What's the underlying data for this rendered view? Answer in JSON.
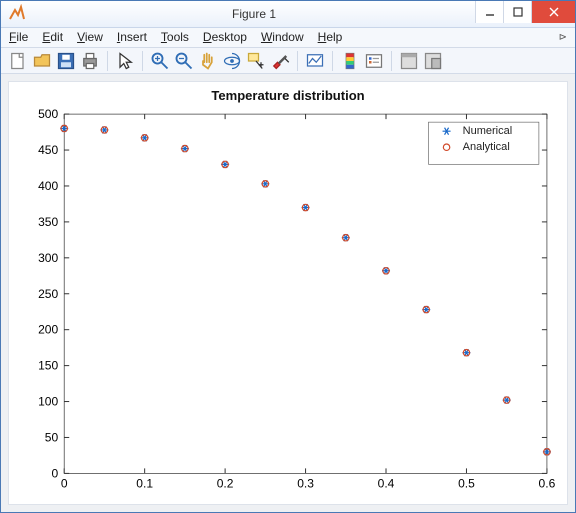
{
  "window": {
    "title": "Figure 1"
  },
  "menu": {
    "file": "File",
    "edit": "Edit",
    "view": "View",
    "insert": "Insert",
    "tools": "Tools",
    "desktop": "Desktop",
    "window": "Window",
    "help": "Help"
  },
  "tool_names": {
    "new": "new-figure",
    "open": "open",
    "save": "save",
    "print": "print",
    "pointer": "pointer",
    "zoomin": "zoom-in",
    "zoomout": "zoom-out",
    "pan": "pan",
    "rotate": "rotate-3d",
    "datacursor": "data-cursor",
    "brush": "brush",
    "link": "link-plots",
    "colorbar": "insert-colorbar",
    "legend": "insert-legend",
    "hide": "hide-tools",
    "dock": "dock-figure"
  },
  "chart_data": {
    "type": "scatter",
    "title": "Temperature distribution",
    "xlabel": "",
    "ylabel": "",
    "xlim": [
      0,
      0.6
    ],
    "ylim": [
      0,
      500
    ],
    "xticks": [
      0,
      0.1,
      0.2,
      0.3,
      0.4,
      0.5,
      0.6
    ],
    "yticks": [
      0,
      50,
      100,
      150,
      200,
      250,
      300,
      350,
      400,
      450,
      500
    ],
    "x": [
      0.0,
      0.05,
      0.1,
      0.15,
      0.2,
      0.25,
      0.3,
      0.35,
      0.4,
      0.45,
      0.5,
      0.55,
      0.6
    ],
    "series": [
      {
        "name": "Numerical",
        "marker": "star",
        "color": "#1868c9",
        "values": [
          480,
          478,
          467,
          452,
          430,
          403,
          370,
          328,
          282,
          228,
          168,
          102,
          30
        ]
      },
      {
        "name": "Analytical",
        "marker": "circle",
        "color": "#d14a2a",
        "values": [
          480,
          478,
          467,
          452,
          430,
          403,
          370,
          328,
          282,
          228,
          168,
          102,
          30
        ]
      }
    ],
    "legend_position": "northeast"
  }
}
